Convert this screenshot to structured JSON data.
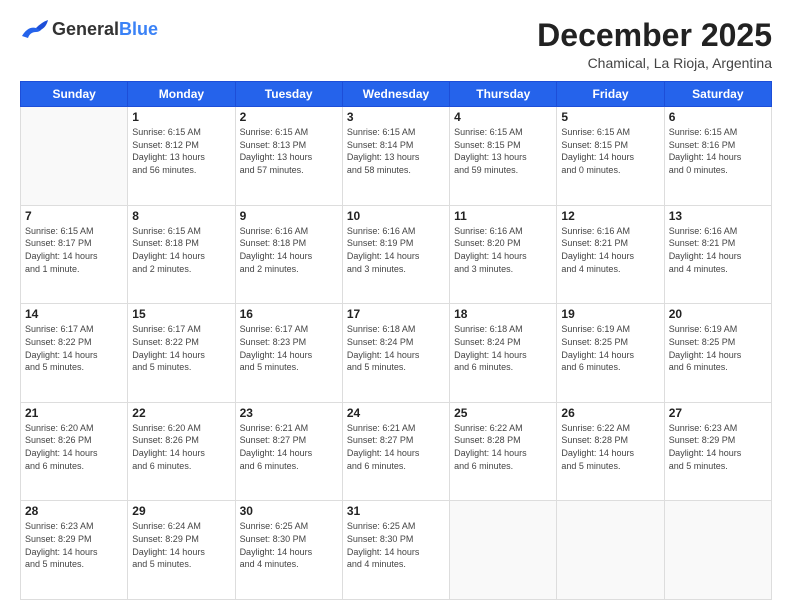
{
  "logo": {
    "general": "General",
    "blue": "Blue"
  },
  "title": "December 2025",
  "subtitle": "Chamical, La Rioja, Argentina",
  "days_of_week": [
    "Sunday",
    "Monday",
    "Tuesday",
    "Wednesday",
    "Thursday",
    "Friday",
    "Saturday"
  ],
  "weeks": [
    [
      {
        "day": "",
        "info": ""
      },
      {
        "day": "1",
        "info": "Sunrise: 6:15 AM\nSunset: 8:12 PM\nDaylight: 13 hours\nand 56 minutes."
      },
      {
        "day": "2",
        "info": "Sunrise: 6:15 AM\nSunset: 8:13 PM\nDaylight: 13 hours\nand 57 minutes."
      },
      {
        "day": "3",
        "info": "Sunrise: 6:15 AM\nSunset: 8:14 PM\nDaylight: 13 hours\nand 58 minutes."
      },
      {
        "day": "4",
        "info": "Sunrise: 6:15 AM\nSunset: 8:15 PM\nDaylight: 13 hours\nand 59 minutes."
      },
      {
        "day": "5",
        "info": "Sunrise: 6:15 AM\nSunset: 8:15 PM\nDaylight: 14 hours\nand 0 minutes."
      },
      {
        "day": "6",
        "info": "Sunrise: 6:15 AM\nSunset: 8:16 PM\nDaylight: 14 hours\nand 0 minutes."
      }
    ],
    [
      {
        "day": "7",
        "info": "Sunrise: 6:15 AM\nSunset: 8:17 PM\nDaylight: 14 hours\nand 1 minute."
      },
      {
        "day": "8",
        "info": "Sunrise: 6:15 AM\nSunset: 8:18 PM\nDaylight: 14 hours\nand 2 minutes."
      },
      {
        "day": "9",
        "info": "Sunrise: 6:16 AM\nSunset: 8:18 PM\nDaylight: 14 hours\nand 2 minutes."
      },
      {
        "day": "10",
        "info": "Sunrise: 6:16 AM\nSunset: 8:19 PM\nDaylight: 14 hours\nand 3 minutes."
      },
      {
        "day": "11",
        "info": "Sunrise: 6:16 AM\nSunset: 8:20 PM\nDaylight: 14 hours\nand 3 minutes."
      },
      {
        "day": "12",
        "info": "Sunrise: 6:16 AM\nSunset: 8:21 PM\nDaylight: 14 hours\nand 4 minutes."
      },
      {
        "day": "13",
        "info": "Sunrise: 6:16 AM\nSunset: 8:21 PM\nDaylight: 14 hours\nand 4 minutes."
      }
    ],
    [
      {
        "day": "14",
        "info": "Sunrise: 6:17 AM\nSunset: 8:22 PM\nDaylight: 14 hours\nand 5 minutes."
      },
      {
        "day": "15",
        "info": "Sunrise: 6:17 AM\nSunset: 8:22 PM\nDaylight: 14 hours\nand 5 minutes."
      },
      {
        "day": "16",
        "info": "Sunrise: 6:17 AM\nSunset: 8:23 PM\nDaylight: 14 hours\nand 5 minutes."
      },
      {
        "day": "17",
        "info": "Sunrise: 6:18 AM\nSunset: 8:24 PM\nDaylight: 14 hours\nand 5 minutes."
      },
      {
        "day": "18",
        "info": "Sunrise: 6:18 AM\nSunset: 8:24 PM\nDaylight: 14 hours\nand 6 minutes."
      },
      {
        "day": "19",
        "info": "Sunrise: 6:19 AM\nSunset: 8:25 PM\nDaylight: 14 hours\nand 6 minutes."
      },
      {
        "day": "20",
        "info": "Sunrise: 6:19 AM\nSunset: 8:25 PM\nDaylight: 14 hours\nand 6 minutes."
      }
    ],
    [
      {
        "day": "21",
        "info": "Sunrise: 6:20 AM\nSunset: 8:26 PM\nDaylight: 14 hours\nand 6 minutes."
      },
      {
        "day": "22",
        "info": "Sunrise: 6:20 AM\nSunset: 8:26 PM\nDaylight: 14 hours\nand 6 minutes."
      },
      {
        "day": "23",
        "info": "Sunrise: 6:21 AM\nSunset: 8:27 PM\nDaylight: 14 hours\nand 6 minutes."
      },
      {
        "day": "24",
        "info": "Sunrise: 6:21 AM\nSunset: 8:27 PM\nDaylight: 14 hours\nand 6 minutes."
      },
      {
        "day": "25",
        "info": "Sunrise: 6:22 AM\nSunset: 8:28 PM\nDaylight: 14 hours\nand 6 minutes."
      },
      {
        "day": "26",
        "info": "Sunrise: 6:22 AM\nSunset: 8:28 PM\nDaylight: 14 hours\nand 5 minutes."
      },
      {
        "day": "27",
        "info": "Sunrise: 6:23 AM\nSunset: 8:29 PM\nDaylight: 14 hours\nand 5 minutes."
      }
    ],
    [
      {
        "day": "28",
        "info": "Sunrise: 6:23 AM\nSunset: 8:29 PM\nDaylight: 14 hours\nand 5 minutes."
      },
      {
        "day": "29",
        "info": "Sunrise: 6:24 AM\nSunset: 8:29 PM\nDaylight: 14 hours\nand 5 minutes."
      },
      {
        "day": "30",
        "info": "Sunrise: 6:25 AM\nSunset: 8:30 PM\nDaylight: 14 hours\nand 4 minutes."
      },
      {
        "day": "31",
        "info": "Sunrise: 6:25 AM\nSunset: 8:30 PM\nDaylight: 14 hours\nand 4 minutes."
      },
      {
        "day": "",
        "info": ""
      },
      {
        "day": "",
        "info": ""
      },
      {
        "day": "",
        "info": ""
      }
    ]
  ]
}
